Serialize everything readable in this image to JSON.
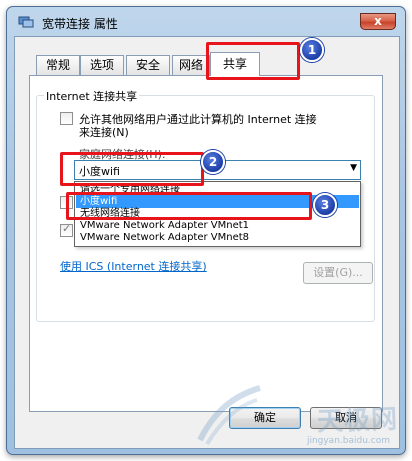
{
  "window": {
    "title": "宽带连接 属性",
    "close_label": "x"
  },
  "tabs": [
    {
      "label": "常规"
    },
    {
      "label": "选项"
    },
    {
      "label": "安全"
    },
    {
      "label": "网络"
    },
    {
      "label": "共享",
      "active": true
    }
  ],
  "sharing": {
    "group_label": "Internet 连接共享",
    "allow_line1": "允许其他网络用户通过此计算机的 Internet 连接",
    "allow_line2": "来连接(N)",
    "allow_checked": false,
    "home_network_label": "家庭网络连接(H):",
    "selected_network": "小度wifi",
    "options": [
      "请选一个专用网络连接",
      "小度wifi",
      "无线网络连接",
      "VMware Network Adapter VMnet1",
      "VMware Network Adapter VMnet8"
    ],
    "selected_index": 1,
    "second_checkbox_checked": true,
    "ics_link": "使用 ICS (Internet 连接共享)",
    "settings_button": "设置(G)..."
  },
  "footer": {
    "ok": "确定",
    "cancel": "取消"
  },
  "annotations": {
    "badge1": "1",
    "badge2": "2",
    "badge3": "3",
    "highlight_color": "#e8141b",
    "badge_color": "#1b3ea8"
  },
  "watermark": {
    "text": "天极网",
    "url": "jingyan.baidu.com"
  },
  "colors": {
    "selection": "#3399ff",
    "link": "#0066cc"
  }
}
